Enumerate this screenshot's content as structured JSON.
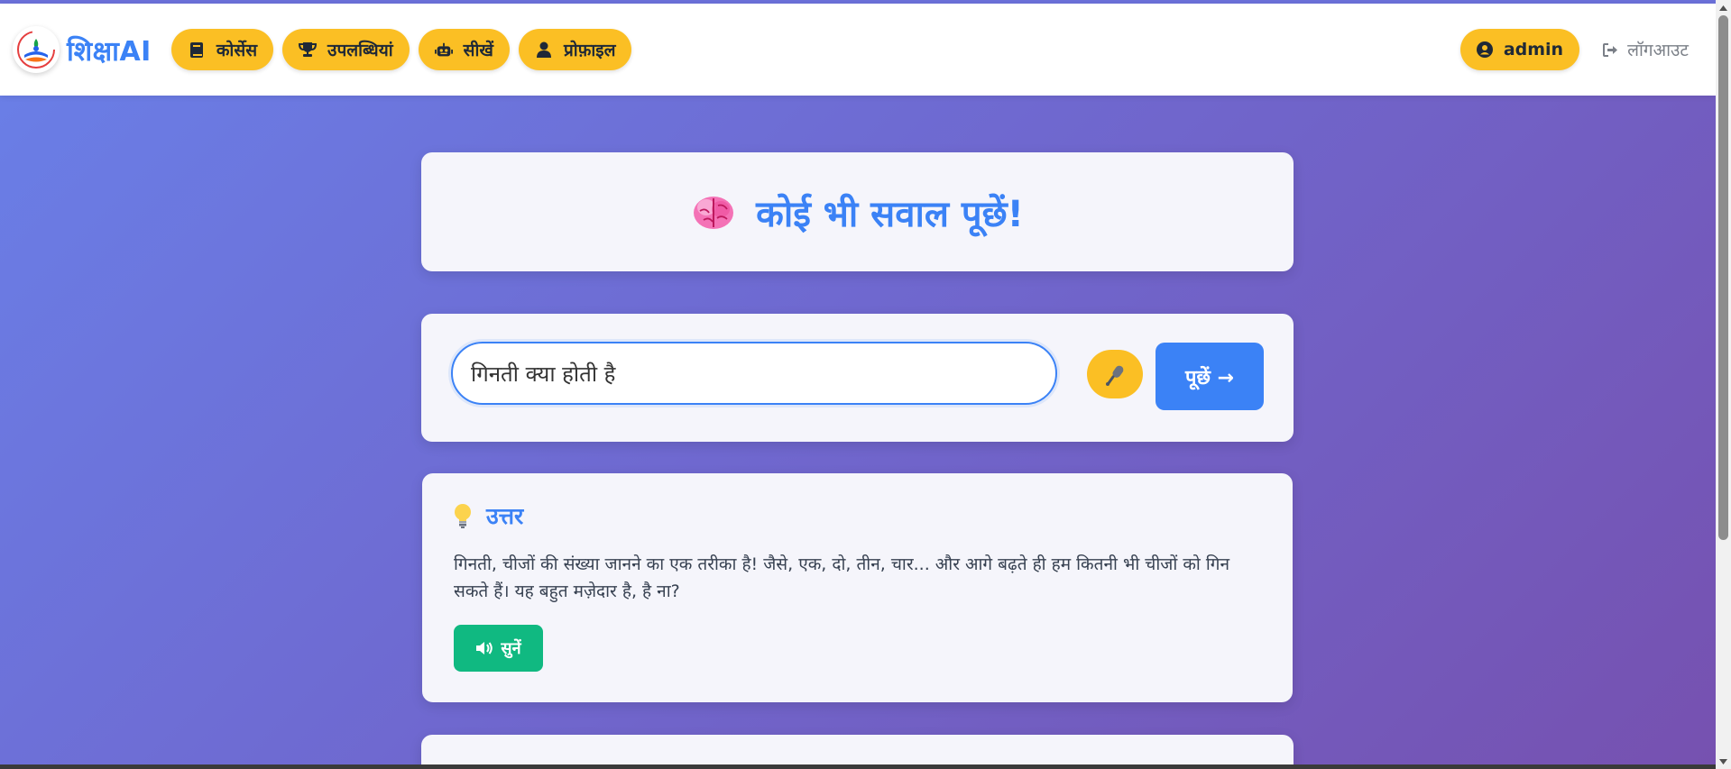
{
  "brand": {
    "name": "शिक्षाAI"
  },
  "nav": {
    "items": [
      {
        "label": "कोर्सेस",
        "icon": "book-icon"
      },
      {
        "label": "उपलब्धियां",
        "icon": "trophy-icon"
      },
      {
        "label": "सीखें",
        "icon": "robot-icon"
      },
      {
        "label": "प्रोफ़ाइल",
        "icon": "user-icon"
      }
    ],
    "user": {
      "label": "admin",
      "icon": "user-circle-icon"
    },
    "logout": {
      "label": "लॉगआउट",
      "icon": "sign-out-icon"
    }
  },
  "title": {
    "emoji": "brain-icon",
    "text": "कोई भी सवाल पूछें!"
  },
  "ask": {
    "input_value": "गिनती क्या होती है",
    "mic_icon": "microphone-icon",
    "button_label": "पूछें →"
  },
  "answer": {
    "icon": "lightbulb-icon",
    "heading": "उत्तर",
    "text": "गिनती, चीजों की संख्या जानने का एक तरीका है! जैसे, एक, दो, तीन, चार... और आगे बढ़ते ही हम कितनी भी चीजों को गिन सकते हैं। यह बहुत मज़ेदार है, है ना?",
    "listen_label": "सुनें",
    "listen_icon": "volume-icon"
  },
  "colors": {
    "primary": "#3b82f6",
    "accent": "#fbbf24",
    "success": "#10b981",
    "gradient_start": "#6a7ee6",
    "gradient_end": "#7651b0"
  }
}
